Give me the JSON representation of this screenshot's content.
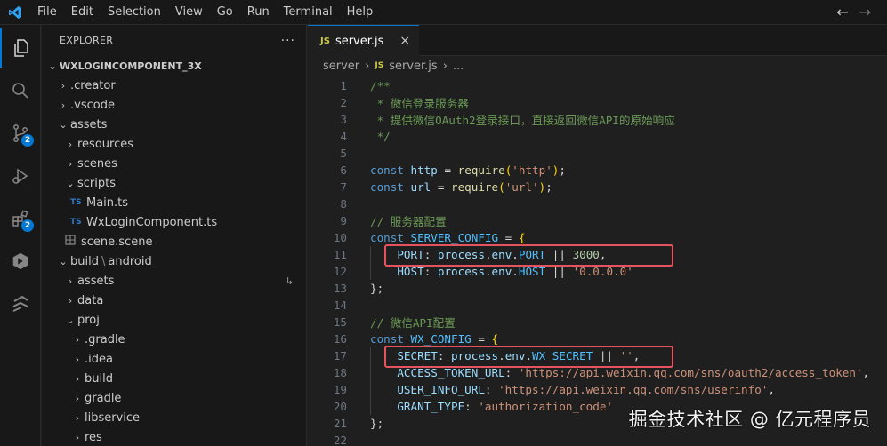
{
  "menu": [
    "File",
    "Edit",
    "Selection",
    "View",
    "Go",
    "Run",
    "Terminal",
    "Help"
  ],
  "activity": {
    "source_control_badge": "2",
    "extensions_badge": "2"
  },
  "explorer": {
    "title": "EXPLORER",
    "more": "···",
    "root": "WXLOGINCOMPONENT_3X",
    "items": [
      {
        "label": ".creator",
        "chev": "›"
      },
      {
        "label": ".vscode",
        "chev": "›"
      },
      {
        "label": "assets",
        "chev": "⌄"
      },
      {
        "label": "resources",
        "chev": "›"
      },
      {
        "label": "scenes",
        "chev": "›"
      },
      {
        "label": "scripts",
        "chev": "⌄"
      },
      {
        "label": "Main.ts",
        "ts": "TS"
      },
      {
        "label": "WxLoginComponent.ts",
        "ts": "TS"
      },
      {
        "label": "scene.scene"
      },
      {
        "label": "build",
        "label2": "android",
        "chev": "⌄"
      },
      {
        "label": "assets",
        "chev": "›"
      },
      {
        "label": "data",
        "chev": "›"
      },
      {
        "label": "proj",
        "chev": "⌄"
      },
      {
        "label": ".gradle",
        "chev": "›"
      },
      {
        "label": ".idea",
        "chev": "›"
      },
      {
        "label": "build",
        "chev": "›"
      },
      {
        "label": "gradle",
        "chev": "›"
      },
      {
        "label": "libservice",
        "chev": "›"
      },
      {
        "label": "res",
        "chev": "›"
      }
    ]
  },
  "editor": {
    "tab_icon": "JS",
    "tab_label": "server.js",
    "tab_close": "×",
    "breadcrumb": {
      "folder": "server",
      "sep": "›",
      "icon": "JS",
      "file": "server.js",
      "sep2": "›",
      "more": "..."
    },
    "line_numbers": [
      "1",
      "2",
      "3",
      "4",
      "5",
      "6",
      "7",
      "8",
      "9",
      "10",
      "11",
      "12",
      "13",
      "14",
      "15",
      "16",
      "17",
      "18",
      "19",
      "20",
      "21",
      "22"
    ],
    "code": {
      "l1": "/**",
      "l2": " * 微信登录服务器",
      "l3": " * 提供微信OAuth2登录接口，直接返回微信API的原始响应",
      "l4": " */",
      "l6_const": "const",
      "l6_name": "http",
      "l6_eq": " = ",
      "l6_fn": "require",
      "l6_str": "'http'",
      "l7_const": "const",
      "l7_name": "url",
      "l7_eq": " = ",
      "l7_fn": "require",
      "l7_str": "'url'",
      "l9": "// 服务器配置",
      "l10_const": "const",
      "l10_name": "SERVER_CONFIG",
      "l11_key": "PORT",
      "l11_obj": "process",
      "l11_env": "env",
      "l11_prop": "PORT",
      "l11_num": "3000",
      "l12_key": "HOST",
      "l12_obj": "process",
      "l12_env": "env",
      "l12_prop": "HOST",
      "l12_str": "'0.0.0.0'",
      "l13": "};",
      "l15": "// 微信API配置",
      "l16_const": "const",
      "l16_name": "WX_CONFIG",
      "l17_key": "SECRET",
      "l17_obj": "process",
      "l17_env": "env",
      "l17_prop": "WX_SECRET",
      "l17_str": "''",
      "l18_key": "ACCESS_TOKEN_URL",
      "l18_str": "'https://api.weixin.qq.com/sns/oauth2/access_token'",
      "l19_key": "USER_INFO_URL",
      "l19_str": "'https://api.weixin.qq.com/sns/userinfo'",
      "l20_key": "GRANT_TYPE",
      "l20_str": "'authorization_code'",
      "l21": "};"
    }
  },
  "watermark": "掘金技术社区 @ 亿元程序员",
  "colors": {
    "accent": "#0078d4",
    "highlight_box": "#e5535f"
  }
}
